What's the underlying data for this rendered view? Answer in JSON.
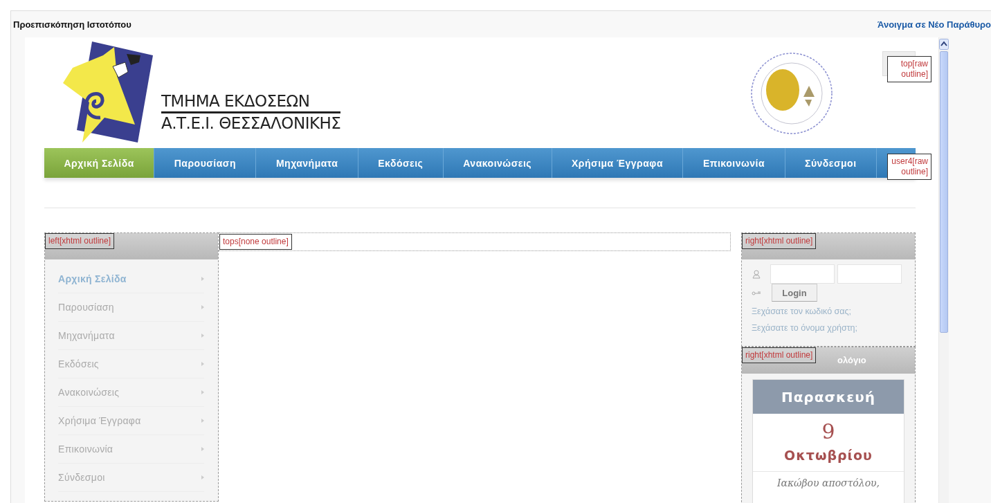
{
  "preview": {
    "title": "Προεπισκόπηση Ιστοτόπου",
    "open_link": "Άνοιγμα σε Νέο Παράθυρο"
  },
  "header": {
    "line1": "ΤΜΗΜΑ ΕΚΔΟΣΕΩΝ",
    "line2": "Α.Τ.Ε.Ι. ΘΕΣΣΑΛΟΝΙΚΗΣ",
    "tag": "top[raw outline]"
  },
  "nav": {
    "tag": "user4[raw outline]",
    "items": [
      {
        "label": "Αρχική Σελίδα",
        "selected": true
      },
      {
        "label": "Παρουσίαση",
        "selected": false
      },
      {
        "label": "Μηχανήματα",
        "selected": false
      },
      {
        "label": "Εκδόσεις",
        "selected": false
      },
      {
        "label": "Ανακοινώσεις",
        "selected": false
      },
      {
        "label": "Χρήσιμα Έγγραφα",
        "selected": false
      },
      {
        "label": "Επικοινωνία",
        "selected": false
      },
      {
        "label": "Σύνδεσμοι",
        "selected": false
      }
    ]
  },
  "left_menu": {
    "tag": "left[xhtml outline]",
    "items": [
      {
        "label": "Αρχική Σελίδα",
        "selected": true
      },
      {
        "label": "Παρουσίαση",
        "selected": false
      },
      {
        "label": "Μηχανήματα",
        "selected": false
      },
      {
        "label": "Εκδόσεις",
        "selected": false
      },
      {
        "label": "Ανακοινώσεις",
        "selected": false
      },
      {
        "label": "Χρήσιμα Έγγραφα",
        "selected": false
      },
      {
        "label": "Επικοινωνία",
        "selected": false
      },
      {
        "label": "Σύνδεσμοι",
        "selected": false
      }
    ]
  },
  "center": {
    "tag": "tops[none outline]"
  },
  "login": {
    "tag": "right[xhtml outline]",
    "button": "Login",
    "links": [
      "Ξεχάσατε τον κωδικό σας;",
      "Ξεχάσατε το όνομα χρήστη;"
    ]
  },
  "calendar": {
    "tag": "right[xhtml outline]",
    "title_fragment": "ολόγιο",
    "day_name": "Παρασκευή",
    "day": "9",
    "month": "Οκτωβρίου",
    "saint": "Ιακώβου αποστόλου,"
  }
}
